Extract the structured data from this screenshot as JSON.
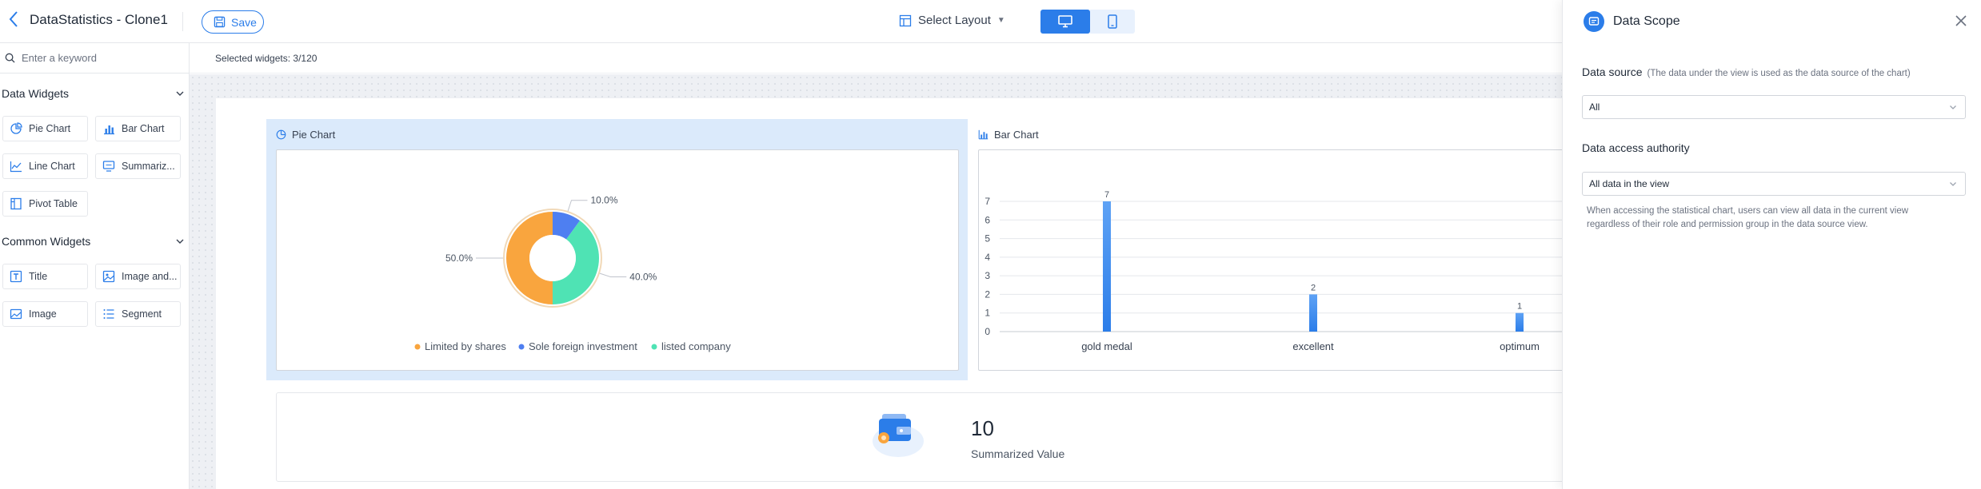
{
  "header": {
    "title": "DataStatistics - Clone1",
    "save_label": "Save",
    "layout_label": "Select Layout"
  },
  "sidebar": {
    "search_placeholder": "Enter a keyword",
    "groups": [
      {
        "title": "Data Widgets",
        "items": [
          "Pie Chart",
          "Bar Chart",
          "Line Chart",
          "Summariz...",
          "Pivot Table"
        ]
      },
      {
        "title": "Common Widgets",
        "items": [
          "Title",
          "Image and...",
          "Image",
          "Segment"
        ]
      }
    ]
  },
  "canvas": {
    "selected_info": "Selected widgets: 3/120",
    "pie_title": "Pie Chart",
    "bar_title": "Bar Chart",
    "summary_value": "10",
    "summary_label": "Summarized Value"
  },
  "chart_data": [
    {
      "type": "pie",
      "title": "Pie Chart",
      "categories": [
        "Limited by shares",
        "Sole foreign investment",
        "listed company"
      ],
      "values": [
        50.0,
        10.0,
        40.0
      ],
      "labels": [
        "50.0%",
        "10.0%",
        "40.0%"
      ],
      "colors": [
        "#f9a53e",
        "#4e7ff1",
        "#4fe3b4"
      ],
      "donut": true,
      "legend": "bottom"
    },
    {
      "type": "bar",
      "title": "Bar Chart",
      "categories": [
        "gold medal",
        "excellent",
        "optimum"
      ],
      "values": [
        7,
        2,
        1
      ],
      "y_ticks": [
        "0",
        "1",
        "2",
        "3",
        "4",
        "5",
        "6",
        "7"
      ],
      "ylim": [
        0,
        7
      ],
      "grid": true,
      "color": "#2b7de9"
    }
  ],
  "panel": {
    "title": "Data Scope",
    "data_source_label": "Data source",
    "data_source_note": "(The data under the view is used as the data source of the chart)",
    "data_source_value": "All",
    "access_label": "Data access authority",
    "access_value": "All data in the view",
    "access_help": "When accessing the statistical chart, users can view all data in the current view regardless of their role and permission group in the data source view."
  }
}
